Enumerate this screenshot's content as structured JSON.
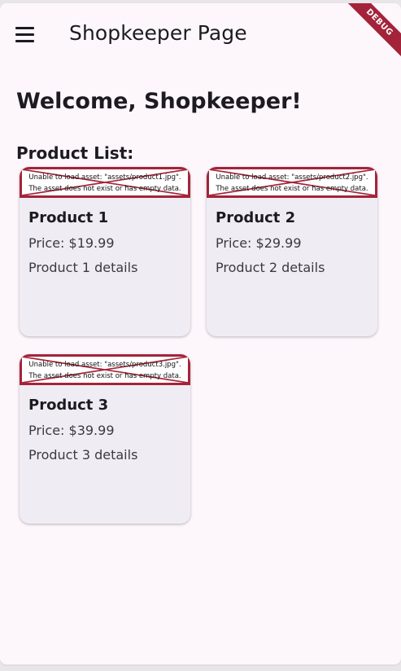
{
  "appbar": {
    "title": "Shopkeeper Page",
    "debug_banner": "DEBUG"
  },
  "welcome": "Welcome, Shopkeeper!",
  "section_title": "Product List:",
  "products": [
    {
      "name": "Product 1",
      "price": "Price: $19.99",
      "details": "Product 1 details",
      "image_error": "Unable to load asset: \"assets/product1.jpg\". The asset does not exist or has empty data."
    },
    {
      "name": "Product 2",
      "price": "Price: $29.99",
      "details": "Product 2 details",
      "image_error": "Unable to load asset: \"assets/product2.jpg\". The asset does not exist or has empty data."
    },
    {
      "name": "Product 3",
      "price": "Price: $39.99",
      "details": "Product 3 details",
      "image_error": "Unable to load asset: \"assets/product3.jpg\". The asset does not exist or has empty data."
    }
  ],
  "colors": {
    "background": "#fdf7fc",
    "card": "#f0ecf3",
    "error_border": "#a3243a",
    "debug_banner": "#a3243a"
  }
}
